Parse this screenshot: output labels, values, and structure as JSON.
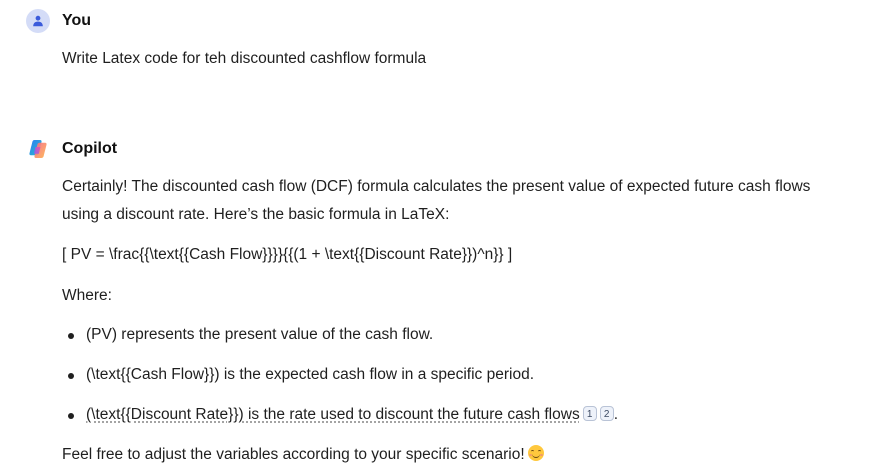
{
  "user_message": {
    "author": "You",
    "text": "Write Latex code for teh discounted cashflow formula"
  },
  "copilot_message": {
    "author": "Copilot",
    "intro_line1": "Certainly! The discounted cash flow (DCF) formula calculates the present value of expected future cash flows",
    "intro_line2": "using a discount rate. Here’s the basic formula in LaTeX:",
    "formula": "[ PV = \\frac{{\\text{{Cash Flow}}}}{{(1 + \\text{{Discount Rate}})^n}} ]",
    "where_label": "Where:",
    "bullets": [
      {
        "text": "(PV) represents the present value of the cash flow."
      },
      {
        "text": "(\\text{{Cash Flow}}) is the expected cash flow in a specific period."
      },
      {
        "text": "(\\text{{Discount Rate}}) is the rate used to discount the future cash flows"
      }
    ],
    "citations": [
      "1",
      "2"
    ],
    "bullet3_end": ".",
    "closing": "Feel free to adjust the variables according to your specific scenario!",
    "closing_emoji": "smiling-face-emoji"
  },
  "colors": {
    "user_avatar_bg": "#d4dcf7",
    "user_avatar_icon": "#3b5bdb",
    "text": "#1f1f1f"
  },
  "icons": {
    "user_avatar": "person-icon",
    "copilot_avatar": "copilot-logo-icon"
  }
}
